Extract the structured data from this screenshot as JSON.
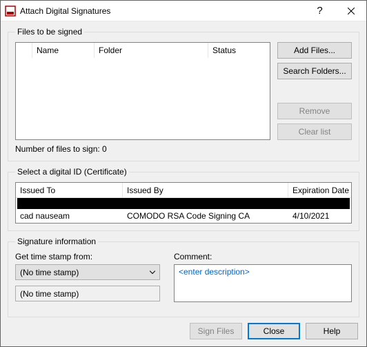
{
  "window": {
    "title": "Attach Digital Signatures"
  },
  "files": {
    "legend": "Files to be signed",
    "columns": {
      "name": "Name",
      "folder": "Folder",
      "status": "Status"
    },
    "buttons": {
      "add": "Add Files...",
      "search": "Search Folders...",
      "remove": "Remove",
      "clear": "Clear list"
    },
    "count_label": "Number of files to sign: 0"
  },
  "cert": {
    "legend": "Select a digital ID (Certificate)",
    "columns": {
      "to": "Issued To",
      "by": "Issued By",
      "exp": "Expiration Date"
    },
    "row": {
      "to": "cad nauseam",
      "by": "COMODO RSA Code Signing CA",
      "exp": "4/10/2021"
    }
  },
  "sig": {
    "legend": "Signature information",
    "stamp_label": "Get time stamp from:",
    "stamp_value": "(No time stamp)",
    "stamp_display": "(No time stamp)",
    "comment_label": "Comment:",
    "comment_placeholder": "<enter description>"
  },
  "bottom": {
    "sign": "Sign Files",
    "close": "Close",
    "help": "Help"
  }
}
